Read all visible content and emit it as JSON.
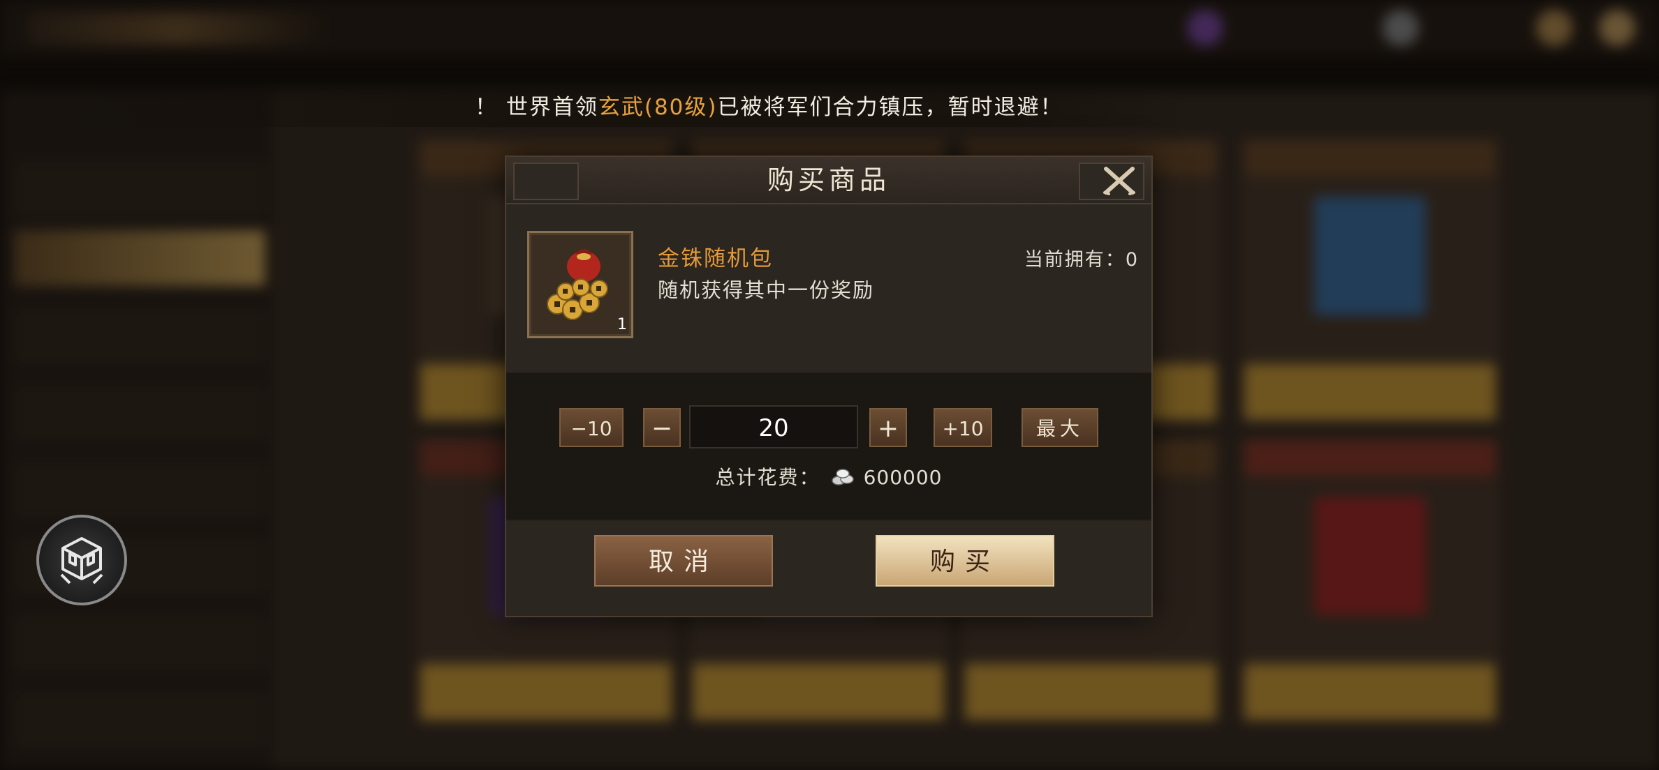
{
  "notice": {
    "prefix": "！ 世界首领",
    "boss": "玄武(80级)",
    "suffix": "已被将军们合力镇压，暂时退避！"
  },
  "dialog": {
    "title": "购买商品",
    "item": {
      "name": "金铢随机包",
      "description": "随机获得其中一份奖励",
      "stack_count": "1",
      "owned_label": "当前拥有：",
      "owned_value": "0"
    },
    "quantity": {
      "minus10_label": "−10",
      "minus_label": "−",
      "value": "20",
      "plus_label": "+",
      "plus10_label": "+10",
      "max_label": "最大"
    },
    "total": {
      "label": "总计花费：",
      "currency_icon": "silver-coins-icon",
      "value": "600000"
    },
    "cancel_label": "取消",
    "buy_label": "购买"
  },
  "colors": {
    "item_name": "#e59a3a",
    "boss_highlight": "#e8a23c",
    "buy_button": "#e6d2a8",
    "cancel_button": "#7a5438"
  }
}
